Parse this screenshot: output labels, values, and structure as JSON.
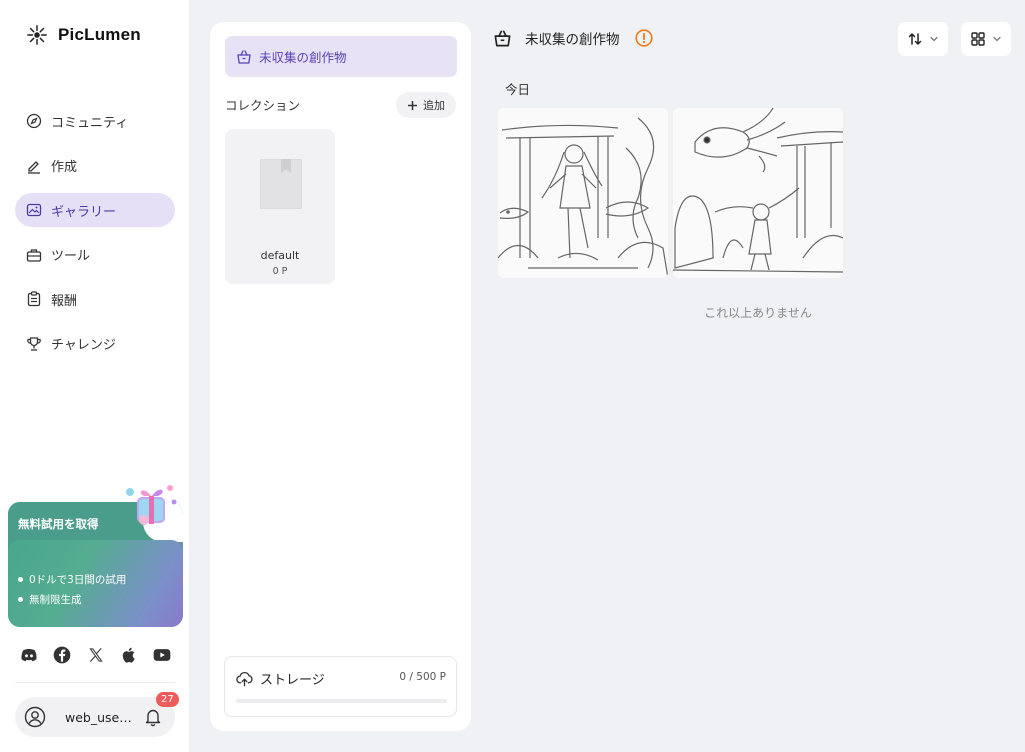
{
  "app": {
    "name": "PicLumen"
  },
  "sidebar": {
    "nav": [
      {
        "label": "コミュニティ",
        "icon": "compass-icon",
        "active": false
      },
      {
        "label": "作成",
        "icon": "pen-icon",
        "active": false
      },
      {
        "label": "ギャラリー",
        "icon": "gallery-icon",
        "active": true
      },
      {
        "label": "ツール",
        "icon": "toolbox-icon",
        "active": false
      },
      {
        "label": "報酬",
        "icon": "clipboard-icon",
        "active": false
      },
      {
        "label": "チャレンジ",
        "icon": "trophy-icon",
        "active": false
      }
    ],
    "promo": {
      "title": "無料試用を取得",
      "items": [
        "0ドルで3日間の試用",
        "無制限生成"
      ]
    },
    "socials": [
      "discord-icon",
      "facebook-icon",
      "x-icon",
      "apple-icon",
      "youtube-icon"
    ],
    "user": {
      "name": "web_user...",
      "notifications": "27"
    }
  },
  "collections": {
    "uncollected_label": "未収集の創作物",
    "header": "コレクション",
    "add_label": "追加",
    "folders": [
      {
        "name": "default",
        "count": "0 P"
      }
    ],
    "storage": {
      "label": "ストレージ",
      "value": "0 / 500 P",
      "used_fraction": 0
    }
  },
  "main": {
    "title": "未収集の創作物",
    "date_group": "今日",
    "images": [
      {
        "alt": "torii-girl-koi-sketch"
      },
      {
        "alt": "fish-torii-girl-sketch"
      }
    ],
    "end_text": "これ以上ありません"
  },
  "colors": {
    "accent": "#7a5ce6",
    "active_bg": "#e5e0f6",
    "warning": "#f07a1a",
    "badge": "#ef5a5a"
  }
}
